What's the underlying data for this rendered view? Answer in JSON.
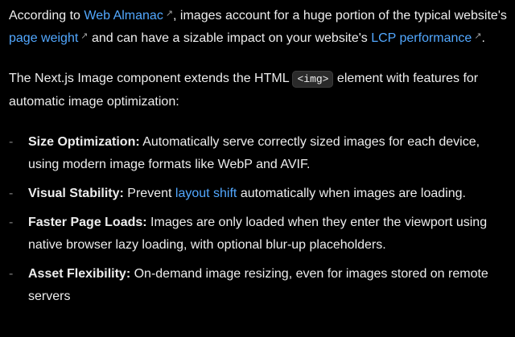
{
  "para1": {
    "t1": "According to ",
    "link1": "Web Almanac",
    "t2": ", images account for a huge portion of the typical website's ",
    "link2": "page weight",
    "t3": " and can have a sizable impact on your website's ",
    "link3": "LCP performance",
    "t4": ".",
    "ext_icon": "↗"
  },
  "para2": {
    "t1": "The Next.js Image component extends the HTML ",
    "code": "<img>",
    "t2": " element with features for automatic image optimization:"
  },
  "list": {
    "bullet": "-",
    "items": [
      {
        "label": "Size Optimization:",
        "text": " Automatically serve correctly sized images for each device, using modern image formats like WebP and AVIF."
      },
      {
        "label": "Visual Stability:",
        "pre": " Prevent ",
        "link": "layout shift",
        "post": " automatically when images are loading."
      },
      {
        "label": "Faster Page Loads:",
        "text": " Images are only loaded when they enter the viewport using native browser lazy loading, with optional blur-up placeholders."
      },
      {
        "label": "Asset Flexibility:",
        "text": " On-demand image resizing, even for images stored on remote servers"
      }
    ]
  }
}
